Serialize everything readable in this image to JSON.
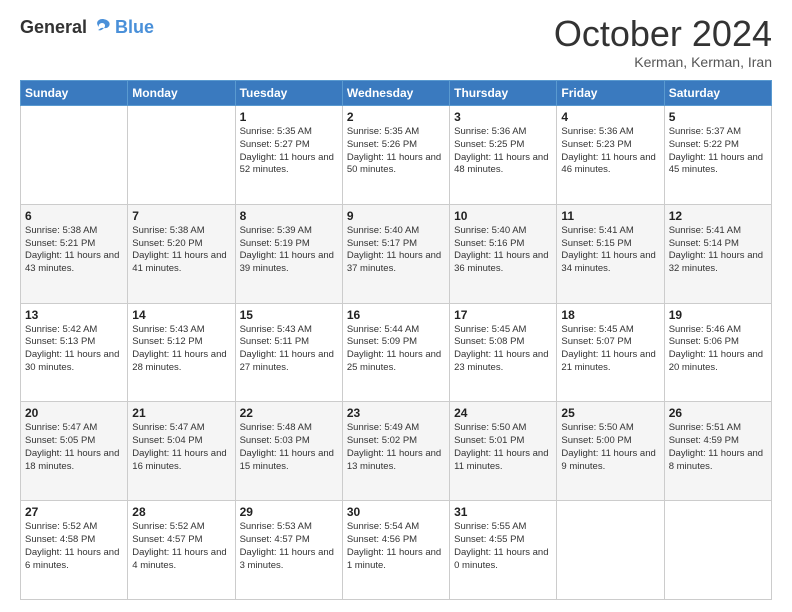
{
  "logo": {
    "general": "General",
    "blue": "Blue"
  },
  "header": {
    "month": "October 2024",
    "location": "Kerman, Kerman, Iran"
  },
  "days_of_week": [
    "Sunday",
    "Monday",
    "Tuesday",
    "Wednesday",
    "Thursday",
    "Friday",
    "Saturday"
  ],
  "weeks": [
    [
      {
        "day": "",
        "info": ""
      },
      {
        "day": "",
        "info": ""
      },
      {
        "day": "1",
        "info": "Sunrise: 5:35 AM\nSunset: 5:27 PM\nDaylight: 11 hours and 52 minutes."
      },
      {
        "day": "2",
        "info": "Sunrise: 5:35 AM\nSunset: 5:26 PM\nDaylight: 11 hours and 50 minutes."
      },
      {
        "day": "3",
        "info": "Sunrise: 5:36 AM\nSunset: 5:25 PM\nDaylight: 11 hours and 48 minutes."
      },
      {
        "day": "4",
        "info": "Sunrise: 5:36 AM\nSunset: 5:23 PM\nDaylight: 11 hours and 46 minutes."
      },
      {
        "day": "5",
        "info": "Sunrise: 5:37 AM\nSunset: 5:22 PM\nDaylight: 11 hours and 45 minutes."
      }
    ],
    [
      {
        "day": "6",
        "info": "Sunrise: 5:38 AM\nSunset: 5:21 PM\nDaylight: 11 hours and 43 minutes."
      },
      {
        "day": "7",
        "info": "Sunrise: 5:38 AM\nSunset: 5:20 PM\nDaylight: 11 hours and 41 minutes."
      },
      {
        "day": "8",
        "info": "Sunrise: 5:39 AM\nSunset: 5:19 PM\nDaylight: 11 hours and 39 minutes."
      },
      {
        "day": "9",
        "info": "Sunrise: 5:40 AM\nSunset: 5:17 PM\nDaylight: 11 hours and 37 minutes."
      },
      {
        "day": "10",
        "info": "Sunrise: 5:40 AM\nSunset: 5:16 PM\nDaylight: 11 hours and 36 minutes."
      },
      {
        "day": "11",
        "info": "Sunrise: 5:41 AM\nSunset: 5:15 PM\nDaylight: 11 hours and 34 minutes."
      },
      {
        "day": "12",
        "info": "Sunrise: 5:41 AM\nSunset: 5:14 PM\nDaylight: 11 hours and 32 minutes."
      }
    ],
    [
      {
        "day": "13",
        "info": "Sunrise: 5:42 AM\nSunset: 5:13 PM\nDaylight: 11 hours and 30 minutes."
      },
      {
        "day": "14",
        "info": "Sunrise: 5:43 AM\nSunset: 5:12 PM\nDaylight: 11 hours and 28 minutes."
      },
      {
        "day": "15",
        "info": "Sunrise: 5:43 AM\nSunset: 5:11 PM\nDaylight: 11 hours and 27 minutes."
      },
      {
        "day": "16",
        "info": "Sunrise: 5:44 AM\nSunset: 5:09 PM\nDaylight: 11 hours and 25 minutes."
      },
      {
        "day": "17",
        "info": "Sunrise: 5:45 AM\nSunset: 5:08 PM\nDaylight: 11 hours and 23 minutes."
      },
      {
        "day": "18",
        "info": "Sunrise: 5:45 AM\nSunset: 5:07 PM\nDaylight: 11 hours and 21 minutes."
      },
      {
        "day": "19",
        "info": "Sunrise: 5:46 AM\nSunset: 5:06 PM\nDaylight: 11 hours and 20 minutes."
      }
    ],
    [
      {
        "day": "20",
        "info": "Sunrise: 5:47 AM\nSunset: 5:05 PM\nDaylight: 11 hours and 18 minutes."
      },
      {
        "day": "21",
        "info": "Sunrise: 5:47 AM\nSunset: 5:04 PM\nDaylight: 11 hours and 16 minutes."
      },
      {
        "day": "22",
        "info": "Sunrise: 5:48 AM\nSunset: 5:03 PM\nDaylight: 11 hours and 15 minutes."
      },
      {
        "day": "23",
        "info": "Sunrise: 5:49 AM\nSunset: 5:02 PM\nDaylight: 11 hours and 13 minutes."
      },
      {
        "day": "24",
        "info": "Sunrise: 5:50 AM\nSunset: 5:01 PM\nDaylight: 11 hours and 11 minutes."
      },
      {
        "day": "25",
        "info": "Sunrise: 5:50 AM\nSunset: 5:00 PM\nDaylight: 11 hours and 9 minutes."
      },
      {
        "day": "26",
        "info": "Sunrise: 5:51 AM\nSunset: 4:59 PM\nDaylight: 11 hours and 8 minutes."
      }
    ],
    [
      {
        "day": "27",
        "info": "Sunrise: 5:52 AM\nSunset: 4:58 PM\nDaylight: 11 hours and 6 minutes."
      },
      {
        "day": "28",
        "info": "Sunrise: 5:52 AM\nSunset: 4:57 PM\nDaylight: 11 hours and 4 minutes."
      },
      {
        "day": "29",
        "info": "Sunrise: 5:53 AM\nSunset: 4:57 PM\nDaylight: 11 hours and 3 minutes."
      },
      {
        "day": "30",
        "info": "Sunrise: 5:54 AM\nSunset: 4:56 PM\nDaylight: 11 hours and 1 minute."
      },
      {
        "day": "31",
        "info": "Sunrise: 5:55 AM\nSunset: 4:55 PM\nDaylight: 11 hours and 0 minutes."
      },
      {
        "day": "",
        "info": ""
      },
      {
        "day": "",
        "info": ""
      }
    ]
  ]
}
